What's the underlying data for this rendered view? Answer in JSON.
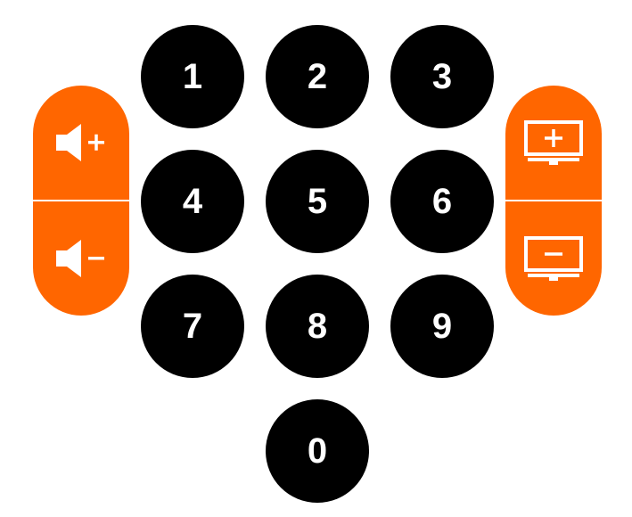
{
  "colors": {
    "accent": "#ff6600",
    "key_bg": "#000000",
    "key_text": "#ffffff"
  },
  "keypad": {
    "keys": [
      "1",
      "2",
      "3",
      "4",
      "5",
      "6",
      "7",
      "8",
      "9",
      "0"
    ]
  },
  "volume": {
    "up_icon": "speaker-plus-icon",
    "down_icon": "speaker-minus-icon"
  },
  "channel": {
    "up_icon": "tv-plus-icon",
    "down_icon": "tv-minus-icon"
  }
}
